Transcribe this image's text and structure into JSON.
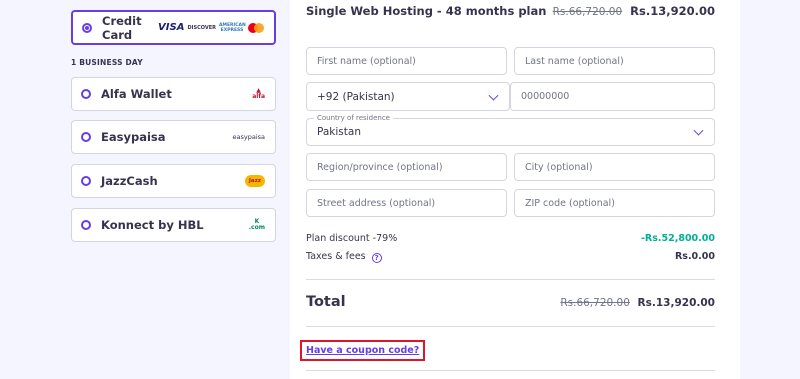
{
  "payment": {
    "credit_card": {
      "label": "Credit Card",
      "logos": [
        "VISA",
        "DISCOVER",
        "AMERICAN EXPRESS",
        "mastercard-logo"
      ]
    },
    "section_label": "1 BUSINESS DAY",
    "options": [
      {
        "label": "Alfa Wallet",
        "logo": "alfa-logo"
      },
      {
        "label": "Easypaisa",
        "logo": "easypaisa"
      },
      {
        "label": "JazzCash",
        "logo": "jazzcash-logo"
      },
      {
        "label": "Konnect by HBL",
        "logo": "konnect-logo"
      }
    ]
  },
  "plan": {
    "title": "Single Web Hosting - 48 months plan",
    "old_price": "Rs.66,720.00",
    "price": "Rs.13,920.00"
  },
  "form": {
    "first_name_placeholder": "First name (optional)",
    "last_name_placeholder": "Last name (optional)",
    "phone_code": "+92 (Pakistan)",
    "phone_placeholder": "00000000",
    "country_label": "Country of residence",
    "country_value": "Pakistan",
    "region_placeholder": "Region/province (optional)",
    "city_placeholder": "City (optional)",
    "street_placeholder": "Street address (optional)",
    "zip_placeholder": "ZIP code (optional)"
  },
  "summary": {
    "discount_label": "Plan discount -79%",
    "discount_value": "-Rs.52,800.00",
    "taxes_label": "Taxes & fees",
    "taxes_value": "Rs.0.00",
    "total_label": "Total",
    "total_old": "Rs.66,720.00",
    "total_value": "Rs.13,920.00"
  },
  "coupon": {
    "label": "Have a coupon code?"
  },
  "colors": {
    "accent": "#673de6",
    "discount": "#00b090",
    "highlight": "#e0142d"
  }
}
